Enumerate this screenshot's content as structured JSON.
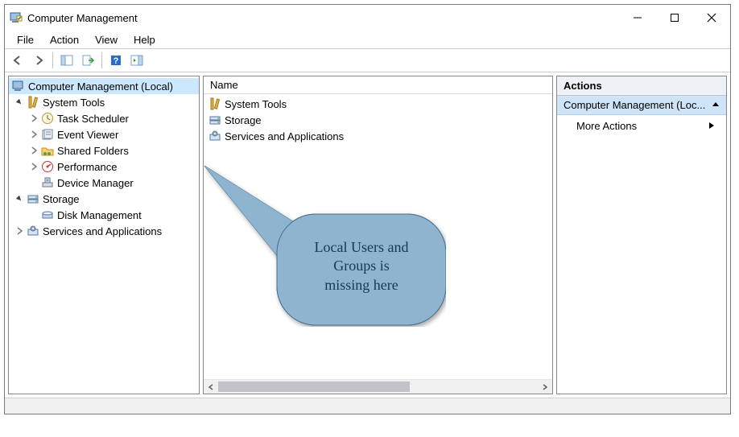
{
  "window": {
    "title": "Computer Management"
  },
  "menu": {
    "file": "File",
    "action": "Action",
    "view": "View",
    "help": "Help"
  },
  "tree": {
    "root": "Computer Management (Local)",
    "systools": "System Tools",
    "taskScheduler": "Task Scheduler",
    "eventViewer": "Event Viewer",
    "sharedFolders": "Shared Folders",
    "performance": "Performance",
    "deviceManager": "Device Manager",
    "storage": "Storage",
    "diskManagement": "Disk Management",
    "servicesApps": "Services and Applications"
  },
  "list": {
    "header": "Name",
    "rows": {
      "systools": "System Tools",
      "storage": "Storage",
      "servicesApps": "Services and Applications"
    }
  },
  "actions": {
    "header": "Actions",
    "context": "Computer Management (Loc...",
    "more": "More Actions"
  },
  "callout": {
    "line1": "Local Users and",
    "line2": "Groups is",
    "line3": "missing here"
  }
}
